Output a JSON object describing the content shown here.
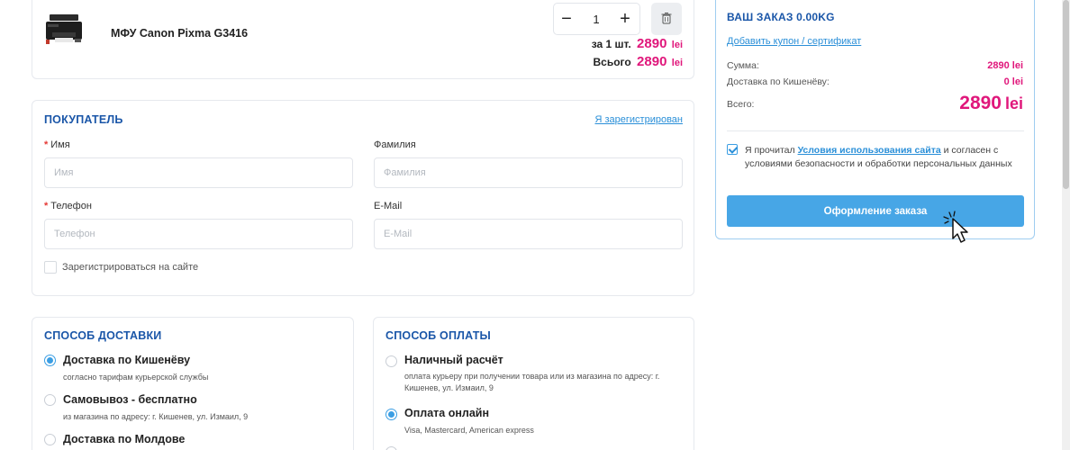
{
  "product": {
    "name": "МФУ Canon Pixma G3416",
    "quantity": "1",
    "unit_label": "за 1 шт.",
    "unit_price": "2890",
    "total_label": "Всього",
    "total_price": "2890",
    "currency": "lei"
  },
  "buyer": {
    "title": "ПОКУПАТЕЛЬ",
    "registered_link": "Я зарегистрирован",
    "first_name": {
      "label": "Имя",
      "placeholder": "Имя",
      "required": true
    },
    "last_name": {
      "label": "Фамилия",
      "placeholder": "Фамилия"
    },
    "phone": {
      "label": "Телефон",
      "placeholder": "Телефон",
      "required": true
    },
    "email": {
      "label": "E-Mail",
      "placeholder": "E-Mail"
    },
    "register_label": "Зарегистрироваться на сайте"
  },
  "delivery": {
    "title": "СПОСОБ ДОСТАВКИ",
    "options": [
      {
        "title": "Доставка по Кишенёву",
        "desc": "согласно тарифам курьерской службы",
        "selected": true
      },
      {
        "title": "Самовывоз - бесплатно",
        "desc": "из магазина по адресу: г. Кишенев, ул. Измаил, 9",
        "selected": false
      },
      {
        "title": "Доставка по Молдове",
        "desc": "",
        "selected": false
      }
    ]
  },
  "payment": {
    "title": "СПОСОБ ОПЛАТЫ",
    "options": [
      {
        "title": "Наличный расчёт",
        "desc": "оплата курьеру при получении товара или из магазина по адресу: г. Кишенев, ул. Измаил, 9",
        "selected": false
      },
      {
        "title": "Оплата онлайн",
        "desc": "Visa, Mastercard, American express",
        "selected": true
      }
    ]
  },
  "order": {
    "title": "ВАШ ЗАКАЗ 0.00KG",
    "coupon_link": "Добавить купон / сертификат",
    "sum_label": "Сумма:",
    "sum_value": "2890",
    "delivery_label": "Доставка по Кишенёву:",
    "delivery_value": "0",
    "total_label": "Всего:",
    "total_value": "2890",
    "currency": "lei",
    "agree_prefix": "Я прочитал",
    "agree_link": "Условия использования сайта",
    "agree_suffix": "и согласен с условиями безопасности и обработки персональных данных",
    "agree_checked": true,
    "submit_label": "Оформление заказа"
  },
  "colors": {
    "accent": "#47a6e6",
    "title_blue": "#1a56a8",
    "price_pink": "#e0177b",
    "link_blue": "#2a8fd8"
  },
  "icons": [
    "printer-product-image",
    "minus-icon",
    "plus-icon",
    "trash-icon",
    "checkmark-icon",
    "pointer-cursor-icon"
  ]
}
